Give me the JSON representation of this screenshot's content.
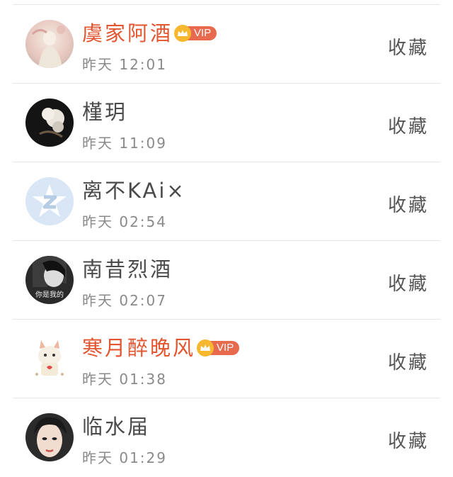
{
  "colors": {
    "vip_name": "#e2552f",
    "normal_name": "#4a4a4a",
    "time": "#8a8a8a",
    "divider": "#e6e6e6",
    "vip_badge": "#e86a4e",
    "vip_crown": "#f5b82e"
  },
  "users": [
    {
      "name": "虞家阿酒",
      "vip": true,
      "vip_label": "VIP",
      "time": "昨天 12:01",
      "action": "收藏",
      "avatar": "avatar-pastel-figure"
    },
    {
      "name": "槿玥",
      "vip": false,
      "vip_label": "",
      "time": "昨天 11:09",
      "action": "收藏",
      "avatar": "avatar-white-flower-dark"
    },
    {
      "name": "离不KAi×",
      "vip": false,
      "vip_label": "",
      "time": "昨天 02:54",
      "action": "收藏",
      "avatar": "avatar-default-star"
    },
    {
      "name": "南昔烈酒",
      "vip": false,
      "vip_label": "",
      "time": "昨天 02:07",
      "action": "收藏",
      "avatar": "avatar-bw-portrait",
      "avatar_caption": "你是我的"
    },
    {
      "name": "寒月醉晚风",
      "vip": true,
      "vip_label": "VIP",
      "time": "昨天 01:38",
      "action": "收藏",
      "avatar": "avatar-cartoon-cat"
    },
    {
      "name": "临水届",
      "vip": false,
      "vip_label": "",
      "time": "昨天 01:29",
      "action": "收藏",
      "avatar": "avatar-selfie"
    }
  ]
}
